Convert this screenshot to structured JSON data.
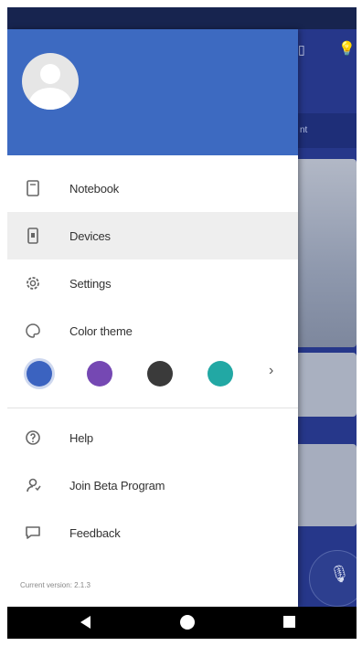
{
  "drawer": {
    "menu": [
      {
        "label": "Notebook",
        "icon": "notebook-icon"
      },
      {
        "label": "Devices",
        "icon": "devices-icon"
      },
      {
        "label": "Settings",
        "icon": "gear-icon"
      },
      {
        "label": "Color theme",
        "icon": "palette-icon"
      }
    ],
    "theme_colors": [
      "#3b63c0",
      "#7548b3",
      "#3a3a3a",
      "#22a8a4"
    ],
    "selected_theme": "#3b63c0",
    "secondary_menu": [
      {
        "label": "Help",
        "icon": "help-icon"
      },
      {
        "label": "Join Beta Program",
        "icon": "beta-icon"
      },
      {
        "label": "Feedback",
        "icon": "feedback-icon"
      }
    ],
    "version": "Current version: 2.1.3"
  },
  "background": {
    "tab_label": "nt"
  },
  "colors": {
    "header": "#3d6ac1",
    "active_row": "#eeeeee"
  }
}
